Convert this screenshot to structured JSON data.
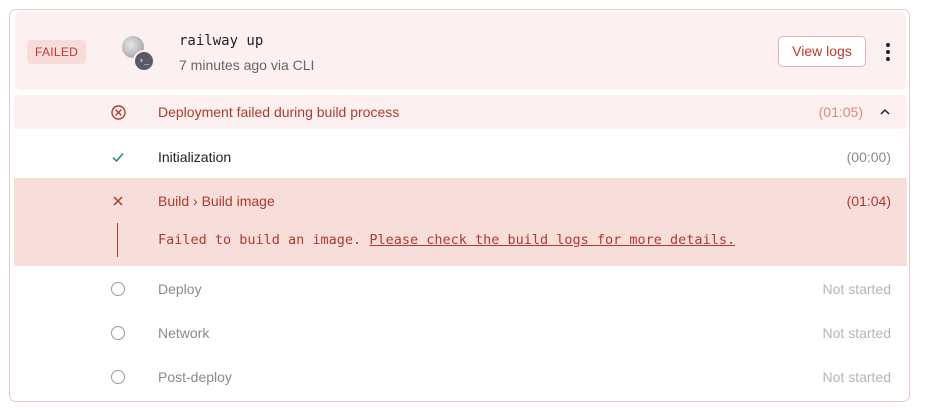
{
  "deployment": {
    "status_badge": "FAILED",
    "title": "railway up",
    "subtitle": "7 minutes ago via CLI",
    "view_logs_label": "View logs",
    "cli_glyph": "›_"
  },
  "failure_summary": {
    "label": "Deployment failed during build process",
    "duration": "(01:05)",
    "chevron": "^"
  },
  "steps": [
    {
      "label": "Initialization",
      "time": "(00:00)",
      "status": "success",
      "icon": "✓"
    },
    {
      "label": "Build › Build image",
      "time": "(01:04)",
      "status": "failed",
      "icon": "×"
    },
    {
      "label": "Deploy",
      "time": "Not started",
      "status": "pending"
    },
    {
      "label": "Network",
      "time": "Not started",
      "status": "pending"
    },
    {
      "label": "Post-deploy",
      "time": "Not started",
      "status": "pending"
    }
  ],
  "build_error": {
    "message": "Failed to build an image. ",
    "link_text": "Please check the build logs for more details."
  },
  "colors": {
    "accent_red": "#c0392b",
    "success_green": "#2e8b57",
    "failed_bg": "#f7dedb",
    "header_bg": "#fcf1f0"
  }
}
